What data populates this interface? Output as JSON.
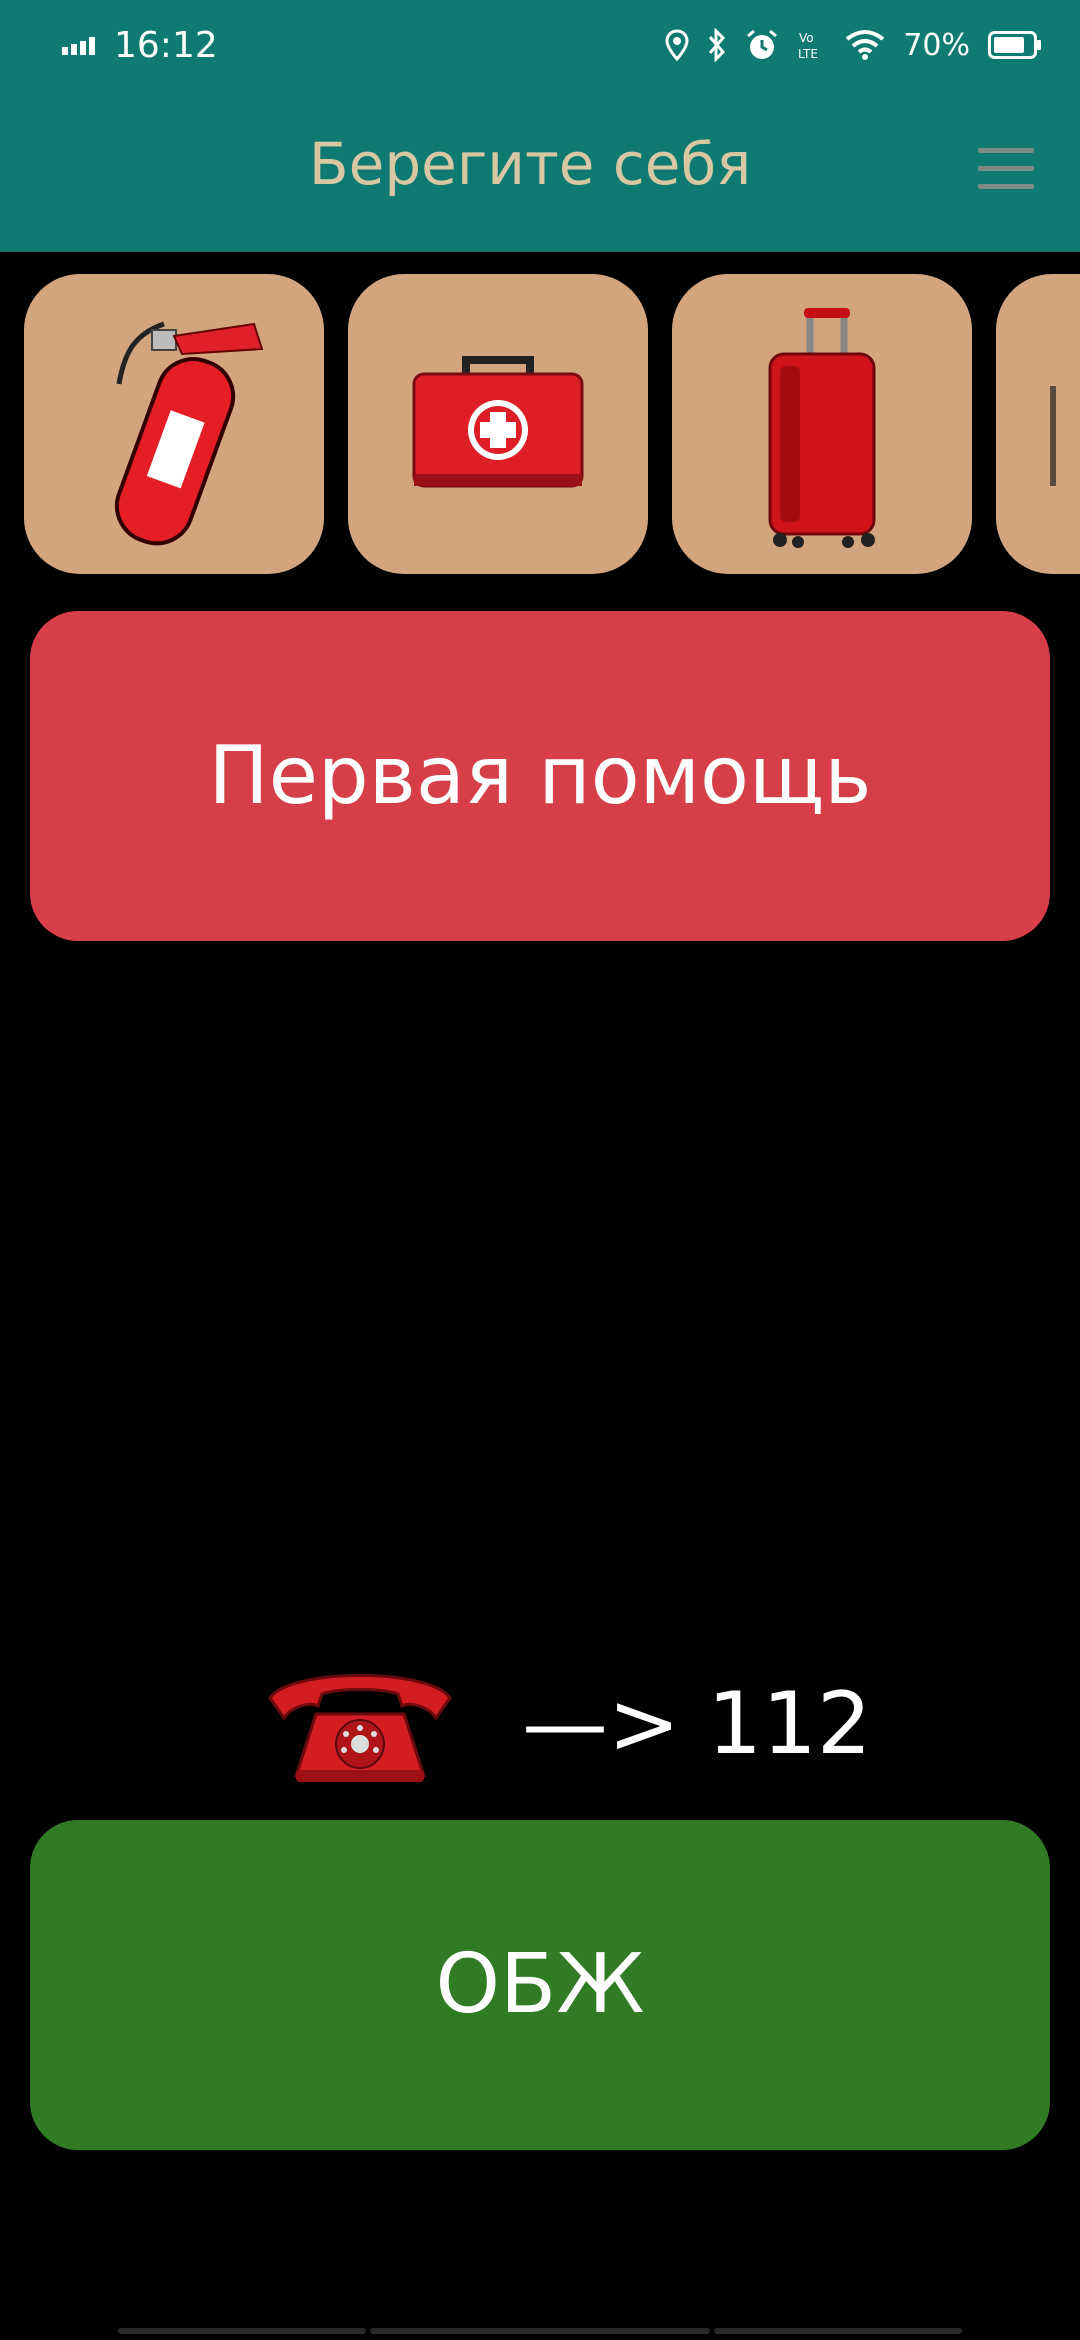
{
  "status_bar": {
    "time": "16:12",
    "battery_percent": "70%",
    "icons": [
      "signal-icon",
      "location-icon",
      "bluetooth-icon",
      "alarm-icon",
      "volte-icon",
      "wifi-icon",
      "battery-icon"
    ]
  },
  "app_bar": {
    "title": "Берегите себя",
    "menu_icon": "hamburger-menu-icon"
  },
  "carousel": {
    "tiles": [
      {
        "icon": "fire-extinguisher-icon"
      },
      {
        "icon": "first-aid-kit-icon"
      },
      {
        "icon": "suitcase-icon"
      },
      {
        "icon": "partial-tile-icon"
      }
    ]
  },
  "first_aid_button": {
    "label": "Первая помощь"
  },
  "emergency": {
    "icon": "telephone-icon",
    "text": "—> 112"
  },
  "obzh_button": {
    "label": "ОБЖ"
  },
  "colors": {
    "app_bar": "#0E7A72",
    "title_text": "#D7C7A2",
    "tile_bg": "#D2A57E",
    "first_aid_bg": "#D63F47",
    "obzh_bg": "#307B24",
    "background": "#000000"
  }
}
